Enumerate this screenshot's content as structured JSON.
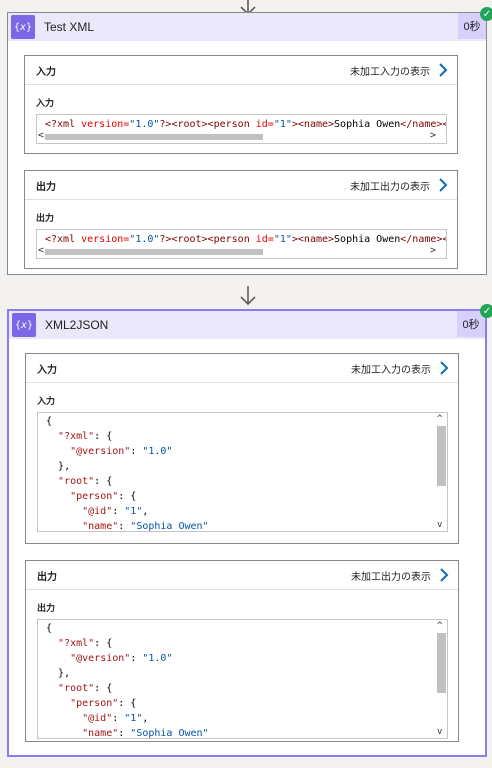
{
  "cards": [
    {
      "title": "Test XML",
      "duration": "0秒",
      "sections": [
        {
          "label": "入力",
          "raw_link": "未加工入力の表示",
          "sub_label": "入力",
          "xml_parts": {
            "decl_open": "<?xml ",
            "version_attr": "version=",
            "version_val": "\"1.0\"",
            "decl_close": "?>",
            "root_tag": "<root>",
            "person_open": "<person ",
            "id_attr": "id=",
            "id_val": "\"1\"",
            "gt": ">",
            "name_tag": "<name>",
            "name_text": "Sophia Owen",
            "name_close": "</name>",
            "tail": "<"
          }
        },
        {
          "label": "出力",
          "raw_link": "未加工出力の表示",
          "sub_label": "出力",
          "xml_parts": {
            "decl_open": "<?xml ",
            "version_attr": "version=",
            "version_val": "\"1.0\"",
            "decl_close": "?>",
            "root_tag": "<root>",
            "person_open": "<person ",
            "id_attr": "id=",
            "id_val": "\"1\"",
            "gt": ">",
            "name_tag": "<name>",
            "name_text": "Sophia Owen",
            "name_close": "</name>",
            "tail": "<"
          }
        }
      ]
    },
    {
      "title": "XML2JSON",
      "duration": "0秒",
      "sections": [
        {
          "label": "入力",
          "raw_link": "未加工入力の表示",
          "sub_label": "入力"
        },
        {
          "label": "出力",
          "raw_link": "未加工出力の表示",
          "sub_label": "出力"
        }
      ]
    }
  ],
  "json_view": {
    "open_brace": "{",
    "xml_key": "\"?xml\"",
    "colon_brace": ": {",
    "version_key": "\"@version\"",
    "colon": ": ",
    "version_val": "\"1.0\"",
    "close_brace_comma": "},",
    "root_key": "\"root\"",
    "person_key": "\"person\"",
    "id_key": "\"@id\"",
    "id_val": "\"1\"",
    "comma": ",",
    "name_key": "\"name\"",
    "name_val": "\"Sophia Owen\""
  },
  "icons": {
    "action": "variable-braces-icon",
    "status": "success-check-icon",
    "flow": "down-arrow-icon",
    "link": "chevron-right-icon"
  },
  "colors": {
    "accent": "#7a68e6",
    "header_bg": "#ebe8fc",
    "success": "#21a557",
    "link_chevron": "#0f6cbd"
  }
}
